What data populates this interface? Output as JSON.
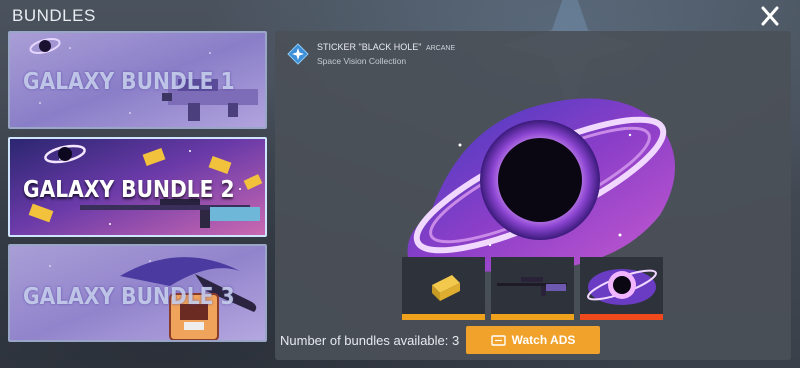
{
  "header": {
    "title": "BUNDLES",
    "close_icon": "close-icon"
  },
  "bundles": [
    {
      "label": "GALAXY BUNDLE 1",
      "selected": false
    },
    {
      "label": "GALAXY BUNDLE 2",
      "selected": true
    },
    {
      "label": "GALAXY BUNDLE 3",
      "selected": false
    }
  ],
  "item": {
    "name": "STICKER \"BLACK HOLE\"",
    "rarity": "ARCANE",
    "collection": "Space Vision Collection",
    "icon": "star-badge-icon"
  },
  "thumbnails": [
    {
      "name": "gold-bar",
      "bar_color": "#f0a21c"
    },
    {
      "name": "sniper-rifle",
      "bar_color": "#f0a21c"
    },
    {
      "name": "black-hole-sticker",
      "bar_color": "#f04a1c"
    }
  ],
  "footer": {
    "count_text": "Number of bundles available: 3",
    "watch_label": "Watch ADS"
  },
  "colors": {
    "accent": "#f0a22a",
    "rarity_bar": "#f04a1c"
  }
}
